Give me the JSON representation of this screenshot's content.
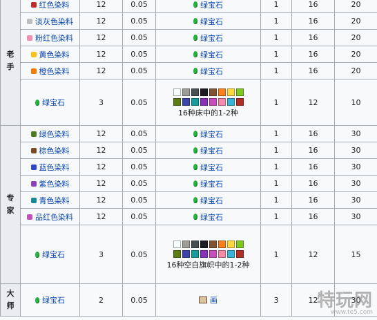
{
  "levels": {
    "novice": "老手",
    "expert": "专家",
    "master": "大师"
  },
  "rows": [
    {
      "item": "红色染料",
      "color": "#c62828",
      "qty": "12",
      "mult": "0.05",
      "pay": "绿宝石",
      "xp_lvl": "1",
      "max": "16",
      "xp": "20"
    },
    {
      "item": "淡灰色染料",
      "color": "#bdbdbd",
      "qty": "12",
      "mult": "0.05",
      "pay": "绿宝石",
      "xp_lvl": "1",
      "max": "16",
      "xp": "20"
    },
    {
      "item": "粉红色染料",
      "color": "#f48fb1",
      "qty": "12",
      "mult": "0.05",
      "pay": "绿宝石",
      "xp_lvl": "1",
      "max": "16",
      "xp": "20"
    },
    {
      "item": "黄色染料",
      "color": "#f9c11a",
      "qty": "12",
      "mult": "0.05",
      "pay": "绿宝石",
      "xp_lvl": "1",
      "max": "16",
      "xp": "20"
    },
    {
      "item": "橙色染料",
      "color": "#f57c00",
      "qty": "12",
      "mult": "0.05",
      "pay": "绿宝石",
      "xp_lvl": "1",
      "max": "16",
      "xp": "20"
    },
    {
      "item": "绿宝石",
      "qty": "3",
      "mult": "0.05",
      "pay_text": "16种床中的1-2种",
      "xp_lvl": "1",
      "max": "12",
      "xp": "10"
    },
    {
      "item": "绿色染料",
      "color": "#4e7a1e",
      "qty": "12",
      "mult": "0.05",
      "pay": "绿宝石",
      "xp_lvl": "1",
      "max": "16",
      "xp": "30"
    },
    {
      "item": "棕色染料",
      "color": "#7b4a23",
      "qty": "12",
      "mult": "0.05",
      "pay": "绿宝石",
      "xp_lvl": "1",
      "max": "16",
      "xp": "30"
    },
    {
      "item": "蓝色染料",
      "color": "#2d47c8",
      "qty": "12",
      "mult": "0.05",
      "pay": "绿宝石",
      "xp_lvl": "1",
      "max": "16",
      "xp": "30"
    },
    {
      "item": "紫色染料",
      "color": "#8e3fbf",
      "qty": "12",
      "mult": "0.05",
      "pay": "绿宝石",
      "xp_lvl": "1",
      "max": "16",
      "xp": "30"
    },
    {
      "item": "青色染料",
      "color": "#168a99",
      "qty": "12",
      "mult": "0.05",
      "pay": "绿宝石",
      "xp_lvl": "1",
      "max": "16",
      "xp": "30"
    },
    {
      "item": "品红色染料",
      "color": "#c44fc0",
      "qty": "12",
      "mult": "0.05",
      "pay": "绿宝石",
      "xp_lvl": "1",
      "max": "16",
      "xp": "30"
    },
    {
      "item": "绿宝石",
      "qty": "3",
      "mult": "0.05",
      "pay_text": "16种空白旗帜中的1-2种",
      "xp_lvl": "1",
      "max": "12",
      "xp": "15"
    },
    {
      "item": "绿宝石",
      "qty": "2",
      "mult": "0.05",
      "pay": "画",
      "xp_lvl": "3",
      "max": "12",
      "xp": "30"
    }
  ],
  "swatches": [
    "#f9fffe",
    "#9d9d97",
    "#474f52",
    "#1d1d21",
    "#835432",
    "#f9801d",
    "#fed83d",
    "#80c71f",
    "#5e7c16",
    "#3c44aa",
    "#169c9c",
    "#8932b8",
    "#c74ebd",
    "#f38baa",
    "#3ab3da",
    "#b02e26"
  ],
  "watermark": {
    "main": "特玩网",
    "sub": "www.te5.com"
  }
}
